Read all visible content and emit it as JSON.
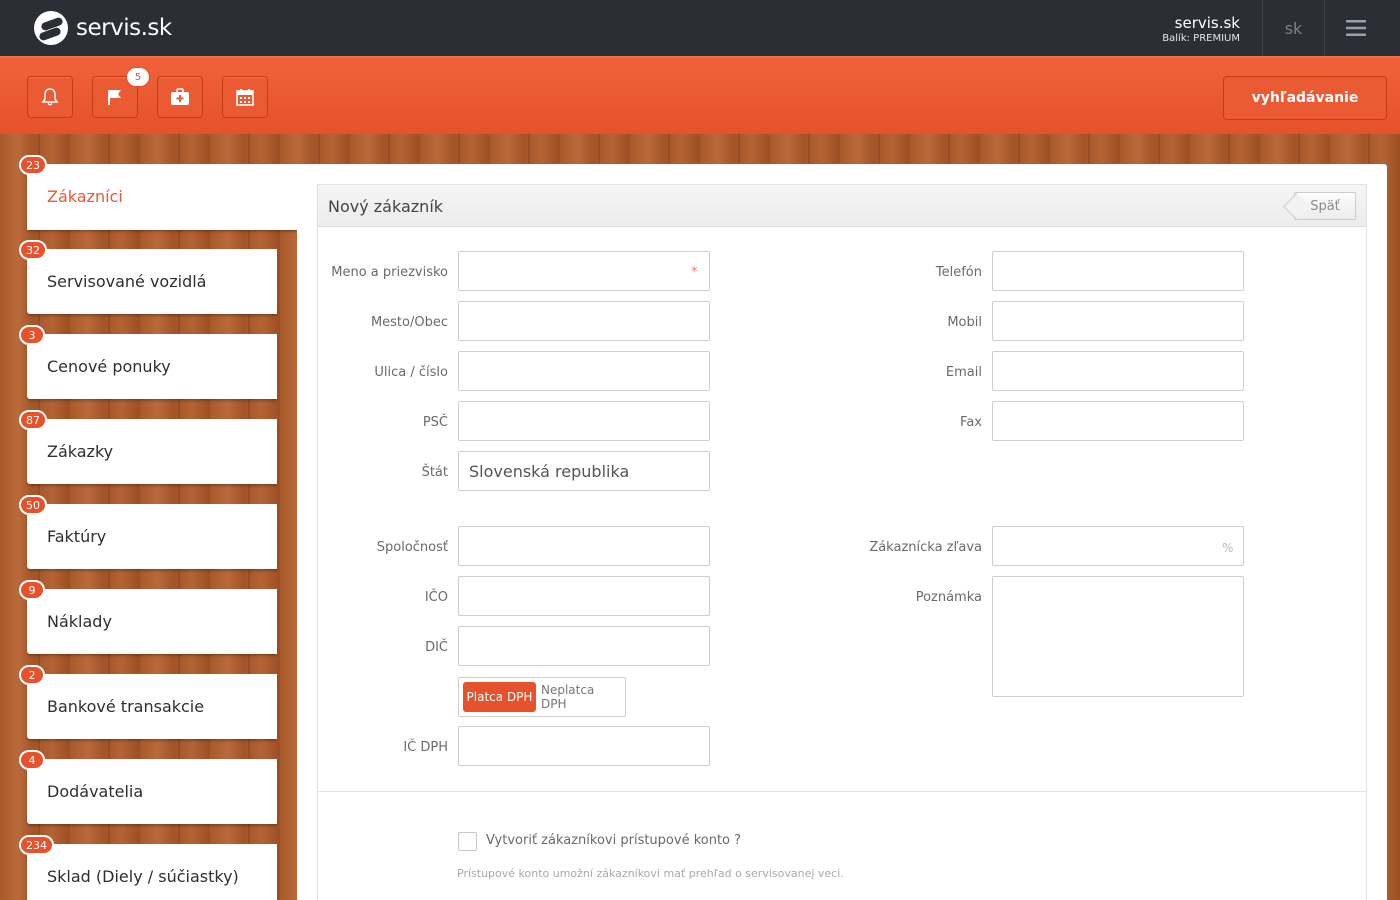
{
  "header": {
    "logo_text": "servis.sk",
    "account_name": "servis.sk",
    "plan": "Balík: PREMIUM",
    "language": "sk"
  },
  "toolbar": {
    "flag_count": "5",
    "search_label": "vyhľadávanie"
  },
  "sidebar": {
    "items": [
      {
        "label": "Zákazníci",
        "count": "23"
      },
      {
        "label": "Servisované vozidlá",
        "count": "32"
      },
      {
        "label": "Cenové ponuky",
        "count": "3"
      },
      {
        "label": "Zákazky",
        "count": "87"
      },
      {
        "label": "Faktúry",
        "count": "50"
      },
      {
        "label": "Náklady",
        "count": "9"
      },
      {
        "label": "Bankové transakcie",
        "count": "2"
      },
      {
        "label": "Dodávatelia",
        "count": "4"
      },
      {
        "label": "Sklad (Diely / súčiastky)",
        "count": "234"
      }
    ]
  },
  "form": {
    "title": "Nový zákazník",
    "back_label": "Späť",
    "required_mark": "*",
    "percent_mark": "%",
    "fields": {
      "name": {
        "label": "Meno a priezvisko",
        "value": ""
      },
      "city": {
        "label": "Mesto/Obec",
        "value": ""
      },
      "street": {
        "label": "Ulica / číslo",
        "value": ""
      },
      "zip": {
        "label": "PSČ",
        "value": ""
      },
      "country": {
        "label": "Štát",
        "value": "Slovenská republika"
      },
      "phone": {
        "label": "Telefón",
        "value": ""
      },
      "mobile": {
        "label": "Mobil",
        "value": ""
      },
      "email": {
        "label": "Email",
        "value": ""
      },
      "fax": {
        "label": "Fax",
        "value": ""
      },
      "company": {
        "label": "Spoločnosť",
        "value": ""
      },
      "ico": {
        "label": "IČO",
        "value": ""
      },
      "dic": {
        "label": "DIČ",
        "value": ""
      },
      "icdph": {
        "label": "IČ DPH",
        "value": ""
      },
      "discount": {
        "label": "Zákaznícka zľava",
        "value": ""
      },
      "note": {
        "label": "Poznámka",
        "value": ""
      }
    },
    "vat": {
      "on_label": "Platca DPH",
      "off_label": "Neplatca DPH"
    },
    "account_checkbox_label": "Vytvoriť zákazníkovi prístupové konto ?",
    "account_hint": "Prístupové konto umožní zákazníkovi mať prehľad o servisovanej veci."
  },
  "colors": {
    "accent": "#e5522c",
    "topbar": "#2b2e34",
    "wood": "#a95a2b"
  }
}
